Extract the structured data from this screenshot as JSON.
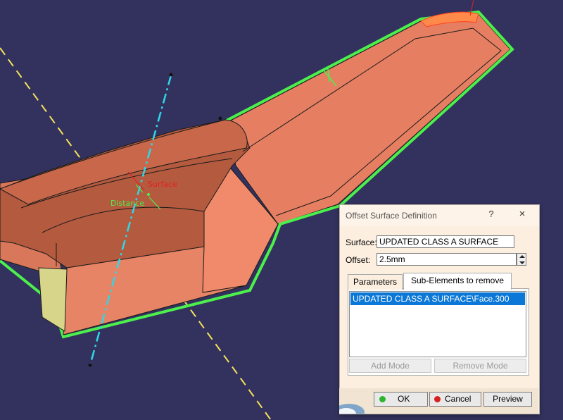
{
  "viewport": {
    "labels": {
      "surface_tag": "Surface",
      "distance_tag": "Distance"
    },
    "colors": {
      "background": "#33325e",
      "part": "#e07b5d",
      "edge_highlight": "#4cf04c",
      "axis_yellow": "#f5e25a",
      "axis_cyan": "#2fd6e8"
    }
  },
  "dialog": {
    "title": "Offset Surface Definition",
    "help_icon": "?",
    "close_icon": "×",
    "surface_label": "Surface:",
    "surface_value": "UPDATED CLASS A SURFACE",
    "offset_label": "Offset:",
    "offset_value": "2.5mm",
    "tabs": [
      {
        "label": "Parameters",
        "active": false
      },
      {
        "label": "Sub-Elements to remove",
        "active": true
      }
    ],
    "list_items": [
      "UPDATED CLASS A SURFACE\\Face.300"
    ],
    "add_mode_label": "Add Mode",
    "remove_mode_label": "Remove Mode",
    "ok_label": "OK",
    "cancel_label": "Cancel",
    "preview_label": "Preview",
    "ok_color": "#2db52d",
    "cancel_color": "#d82020"
  }
}
